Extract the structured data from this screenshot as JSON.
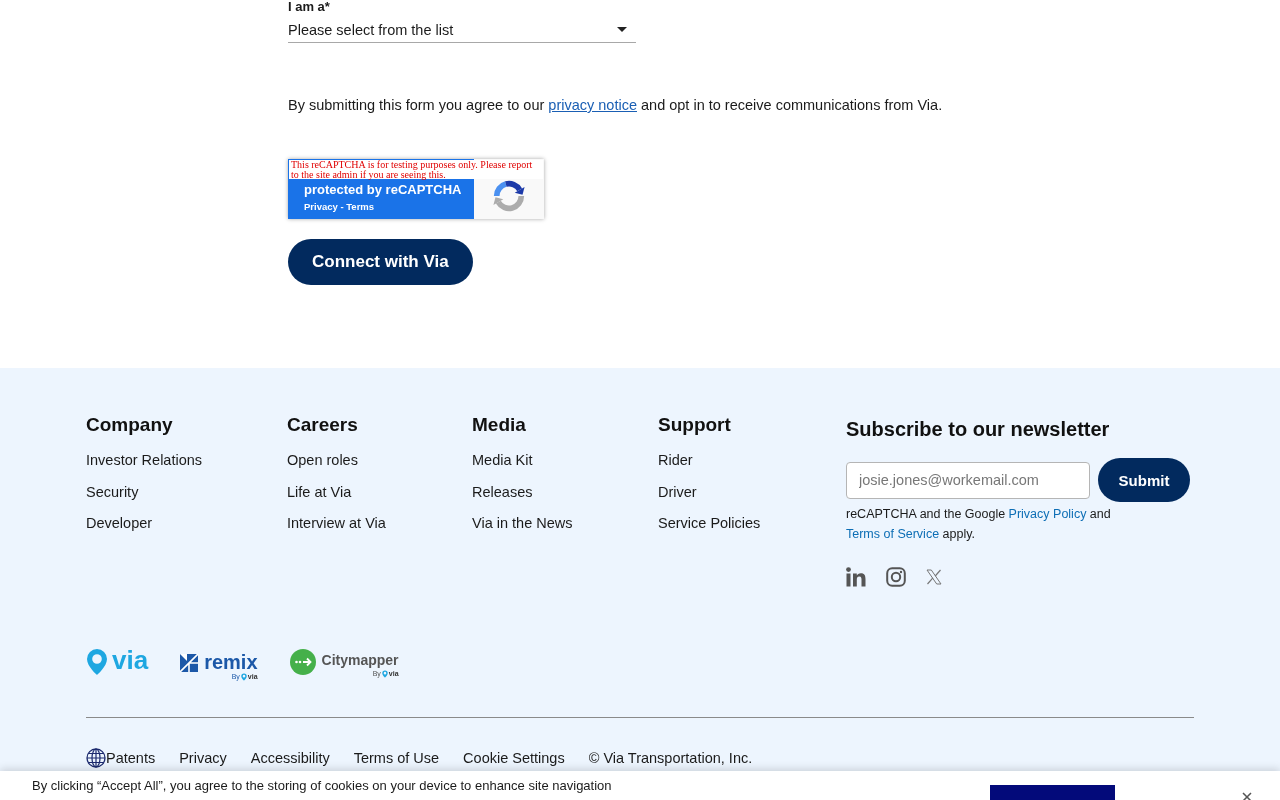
{
  "form": {
    "field_label": "I am a*",
    "select": {
      "placeholder": "Please select from the list"
    },
    "consent": [
      {
        "kind": "text",
        "text": "By submitting this form you agree to our "
      },
      {
        "kind": "link",
        "text": "privacy notice"
      },
      {
        "kind": "text",
        "text": " and opt in to receive communications from Via."
      }
    ],
    "recaptcha": {
      "notice": "This reCAPTCHA is for testing purposes only. Please report to the site admin if you are seeing this.",
      "title": "protected by reCAPTCHA",
      "links": "Privacy - Terms"
    },
    "submit_button": "Connect with Via"
  },
  "footer": {
    "columns": [
      {
        "heading": "Company",
        "links": [
          "Investor Relations",
          "Security",
          "Developer"
        ]
      },
      {
        "heading": "Careers",
        "links": [
          "Open roles",
          "Life at Via",
          "Interview at Via"
        ]
      },
      {
        "heading": "Media",
        "links": [
          "Media Kit",
          "Releases",
          "Via in the News"
        ]
      },
      {
        "heading": "Support",
        "links": [
          "Rider",
          "Driver",
          "Service Policies"
        ]
      }
    ],
    "newsletter": {
      "heading": "Subscribe to our newsletter",
      "email_field": {
        "placeholder": "josie.jones@workemail.com"
      },
      "submit_button": "Submit",
      "legal": [
        {
          "kind": "text",
          "text": "reCAPTCHA and the Google "
        },
        {
          "kind": "link",
          "text": "Privacy Policy"
        },
        {
          "kind": "text",
          "text": " and "
        },
        {
          "kind": "link",
          "text": "Terms of Service"
        },
        {
          "kind": "text",
          "text": " apply."
        }
      ]
    },
    "logos": [
      {
        "kind": "pin",
        "wordmark": "via"
      },
      {
        "kind": "tile",
        "wordmark": "remix",
        "byline": "By",
        "byline_brand": "via"
      },
      {
        "kind": "disc",
        "wordmark": "Citymapper",
        "byline": "By",
        "byline_brand": "via"
      }
    ],
    "bottom_links": [
      "Patents",
      "Privacy",
      "Accessibility",
      "Terms of Use",
      "Cookie Settings"
    ],
    "copyright": "© Via Transportation, Inc."
  },
  "cookie_banner": {
    "text": "By clicking “Accept All”, you agree to the storing of cookies on your device to enhance site navigation"
  }
}
